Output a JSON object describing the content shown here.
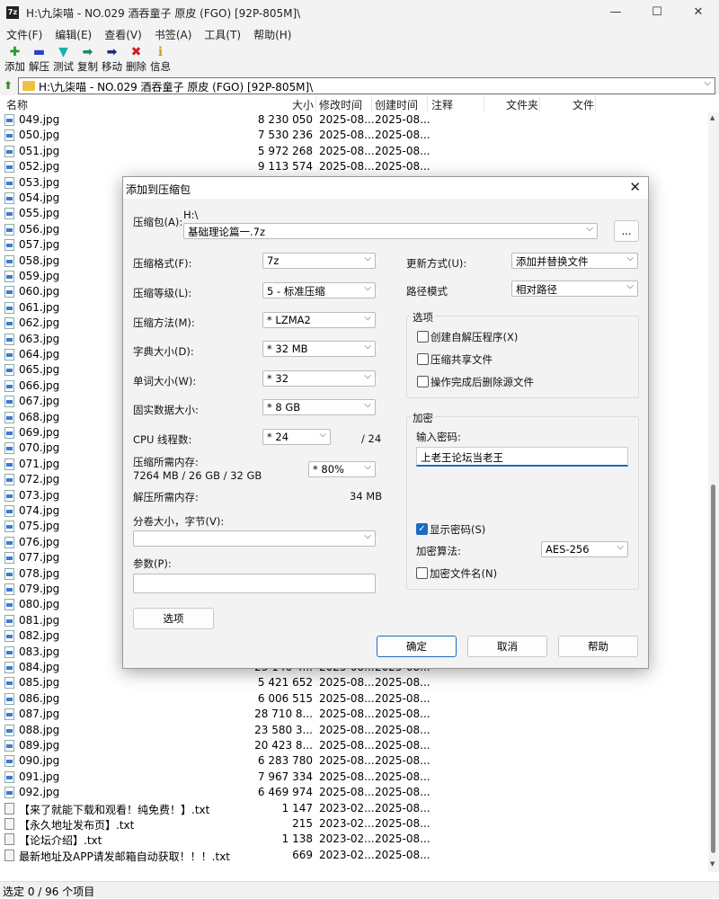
{
  "window": {
    "app_icon": "7z",
    "title": "H:\\九柒喵 - NO.029 酒吞童子 原皮 (FGO) [92P-805M]\\",
    "minimize": "—",
    "maximize": "☐",
    "close": "✕"
  },
  "menu": [
    "文件(F)",
    "编辑(E)",
    "查看(V)",
    "书签(A)",
    "工具(T)",
    "帮助(H)"
  ],
  "toolbar": [
    {
      "label": "添加",
      "icon": "plus-icon",
      "glyph": "✚",
      "color": "#1e9e2e"
    },
    {
      "label": "解压",
      "icon": "minus-icon",
      "glyph": "▬",
      "color": "#2b3ec8"
    },
    {
      "label": "测试",
      "icon": "check-icon",
      "glyph": "▼",
      "color": "#1ab0b0"
    },
    {
      "label": "复制",
      "icon": "copy-arrow-icon",
      "glyph": "➡",
      "color": "#1a8a6a"
    },
    {
      "label": "移动",
      "icon": "move-arrow-icon",
      "glyph": "➡",
      "color": "#1a2a8a"
    },
    {
      "label": "删除",
      "icon": "delete-icon",
      "glyph": "✖",
      "color": "#d02020"
    },
    {
      "label": "信息",
      "icon": "info-icon",
      "glyph": "ℹ",
      "color": "#c8a020"
    }
  ],
  "address": {
    "path": "H:\\九柒喵 - NO.029 酒吞童子 原皮 (FGO) [92P-805M]\\"
  },
  "columns": {
    "name": "名称",
    "size": "大小",
    "modified": "修改时间",
    "created": "创建时间",
    "comment": "注释",
    "folders": "文件夹",
    "files": "文件"
  },
  "files": [
    {
      "name": "049.jpg",
      "size": "8 230 050",
      "mod": "2025-08...",
      "cre": "2025-08...",
      "type": "jpg"
    },
    {
      "name": "050.jpg",
      "size": "7 530 236",
      "mod": "2025-08...",
      "cre": "2025-08...",
      "type": "jpg"
    },
    {
      "name": "051.jpg",
      "size": "5 972 268",
      "mod": "2025-08...",
      "cre": "2025-08...",
      "type": "jpg"
    },
    {
      "name": "052.jpg",
      "size": "9 113 574",
      "mod": "2025-08...",
      "cre": "2025-08...",
      "type": "jpg"
    },
    {
      "name": "053.jpg",
      "size": "",
      "mod": "",
      "cre": "",
      "type": "jpg"
    },
    {
      "name": "054.jpg",
      "size": "",
      "mod": "",
      "cre": "",
      "type": "jpg"
    },
    {
      "name": "055.jpg",
      "size": "",
      "mod": "",
      "cre": "",
      "type": "jpg"
    },
    {
      "name": "056.jpg",
      "size": "",
      "mod": "",
      "cre": "",
      "type": "jpg"
    },
    {
      "name": "057.jpg",
      "size": "",
      "mod": "",
      "cre": "",
      "type": "jpg"
    },
    {
      "name": "058.jpg",
      "size": "",
      "mod": "",
      "cre": "",
      "type": "jpg"
    },
    {
      "name": "059.jpg",
      "size": "",
      "mod": "",
      "cre": "",
      "type": "jpg"
    },
    {
      "name": "060.jpg",
      "size": "",
      "mod": "",
      "cre": "",
      "type": "jpg"
    },
    {
      "name": "061.jpg",
      "size": "",
      "mod": "",
      "cre": "",
      "type": "jpg"
    },
    {
      "name": "062.jpg",
      "size": "",
      "mod": "",
      "cre": "",
      "type": "jpg"
    },
    {
      "name": "063.jpg",
      "size": "",
      "mod": "",
      "cre": "",
      "type": "jpg"
    },
    {
      "name": "064.jpg",
      "size": "",
      "mod": "",
      "cre": "",
      "type": "jpg"
    },
    {
      "name": "065.jpg",
      "size": "",
      "mod": "",
      "cre": "",
      "type": "jpg"
    },
    {
      "name": "066.jpg",
      "size": "",
      "mod": "",
      "cre": "",
      "type": "jpg"
    },
    {
      "name": "067.jpg",
      "size": "",
      "mod": "",
      "cre": "",
      "type": "jpg"
    },
    {
      "name": "068.jpg",
      "size": "",
      "mod": "",
      "cre": "",
      "type": "jpg"
    },
    {
      "name": "069.jpg",
      "size": "",
      "mod": "",
      "cre": "",
      "type": "jpg"
    },
    {
      "name": "070.jpg",
      "size": "",
      "mod": "",
      "cre": "",
      "type": "jpg"
    },
    {
      "name": "071.jpg",
      "size": "",
      "mod": "",
      "cre": "",
      "type": "jpg"
    },
    {
      "name": "072.jpg",
      "size": "",
      "mod": "",
      "cre": "",
      "type": "jpg"
    },
    {
      "name": "073.jpg",
      "size": "",
      "mod": "",
      "cre": "",
      "type": "jpg"
    },
    {
      "name": "074.jpg",
      "size": "",
      "mod": "",
      "cre": "",
      "type": "jpg"
    },
    {
      "name": "075.jpg",
      "size": "",
      "mod": "",
      "cre": "",
      "type": "jpg"
    },
    {
      "name": "076.jpg",
      "size": "",
      "mod": "",
      "cre": "",
      "type": "jpg"
    },
    {
      "name": "077.jpg",
      "size": "",
      "mod": "",
      "cre": "",
      "type": "jpg"
    },
    {
      "name": "078.jpg",
      "size": "",
      "mod": "",
      "cre": "",
      "type": "jpg"
    },
    {
      "name": "079.jpg",
      "size": "",
      "mod": "",
      "cre": "",
      "type": "jpg"
    },
    {
      "name": "080.jpg",
      "size": "",
      "mod": "",
      "cre": "",
      "type": "jpg"
    },
    {
      "name": "081.jpg",
      "size": "",
      "mod": "",
      "cre": "",
      "type": "jpg"
    },
    {
      "name": "082.jpg",
      "size": "",
      "mod": "",
      "cre": "",
      "type": "jpg"
    },
    {
      "name": "083.jpg",
      "size": "",
      "mod": "",
      "cre": "",
      "type": "jpg"
    },
    {
      "name": "084.jpg",
      "size": "23 146 4...",
      "mod": "2025-08...",
      "cre": "2025-08...",
      "type": "jpg"
    },
    {
      "name": "085.jpg",
      "size": "5 421 652",
      "mod": "2025-08...",
      "cre": "2025-08...",
      "type": "jpg"
    },
    {
      "name": "086.jpg",
      "size": "6 006 515",
      "mod": "2025-08...",
      "cre": "2025-08...",
      "type": "jpg"
    },
    {
      "name": "087.jpg",
      "size": "28 710 8...",
      "mod": "2025-08...",
      "cre": "2025-08...",
      "type": "jpg"
    },
    {
      "name": "088.jpg",
      "size": "23 580 3...",
      "mod": "2025-08...",
      "cre": "2025-08...",
      "type": "jpg"
    },
    {
      "name": "089.jpg",
      "size": "20 423 8...",
      "mod": "2025-08...",
      "cre": "2025-08...",
      "type": "jpg"
    },
    {
      "name": "090.jpg",
      "size": "6 283 780",
      "mod": "2025-08...",
      "cre": "2025-08...",
      "type": "jpg"
    },
    {
      "name": "091.jpg",
      "size": "7 967 334",
      "mod": "2025-08...",
      "cre": "2025-08...",
      "type": "jpg"
    },
    {
      "name": "092.jpg",
      "size": "6 469 974",
      "mod": "2025-08...",
      "cre": "2025-08...",
      "type": "jpg"
    },
    {
      "name": "【来了就能下载和观看！纯免费！】.txt",
      "size": "1 147",
      "mod": "2023-02...",
      "cre": "2025-08...",
      "type": "txt"
    },
    {
      "name": "【永久地址发布页】.txt",
      "size": "215",
      "mod": "2023-02...",
      "cre": "2025-08...",
      "type": "txt"
    },
    {
      "name": "【论坛介绍】.txt",
      "size": "1 138",
      "mod": "2023-02...",
      "cre": "2025-08...",
      "type": "txt"
    },
    {
      "name": "最新地址及APP请发邮箱自动获取！！！.txt",
      "size": "669",
      "mod": "2023-02...",
      "cre": "2025-08...",
      "type": "txt"
    }
  ],
  "status": {
    "text": "选定 0 / 96 个项目"
  },
  "dialog": {
    "title": "添加到压缩包",
    "close": "✕",
    "archive_label": "压缩包(A):",
    "archive_dir": "H:\\",
    "archive_name": "基础理论篇一.7z",
    "browse": "...",
    "format_label": "压缩格式(F):",
    "format": "7z",
    "level_label": "压缩等级(L):",
    "level": "5 - 标准压缩",
    "method_label": "压缩方法(M):",
    "method": "* LZMA2",
    "dict_label": "字典大小(D):",
    "dict": "* 32 MB",
    "word_label": "单词大小(W):",
    "word": "* 32",
    "solid_label": "固实数据大小:",
    "solid": "* 8 GB",
    "cpu_label": "CPU 线程数:",
    "cpu": "* 24",
    "cpu_total": "/ 24",
    "mem_label": "压缩所需内存:",
    "mem_detail": "7264 MB / 26 GB / 32 GB",
    "mem_pct": "* 80%",
    "demem_label": "解压所需内存:",
    "demem": "34 MB",
    "split_label": "分卷大小，字节(V):",
    "split": "",
    "params_label": "参数(P):",
    "params": "",
    "options_btn": "选项",
    "update_label": "更新方式(U):",
    "update": "添加并替换文件",
    "pathmode_label": "路径模式",
    "pathmode": "相对路径",
    "options_group": "选项",
    "opt_sfx": "创建自解压程序(X)",
    "opt_shared": "压缩共享文件",
    "opt_delete": "操作完成后删除源文件",
    "enc_group": "加密",
    "pwd_label": "输入密码:",
    "pwd": "上老王论坛当老王",
    "show_pwd": "显示密码(S)",
    "enc_method_label": "加密算法:",
    "enc_method": "AES-256",
    "enc_names": "加密文件名(N)",
    "ok": "确定",
    "cancel": "取消",
    "help": "帮助"
  },
  "accent": "#1a6bc1"
}
